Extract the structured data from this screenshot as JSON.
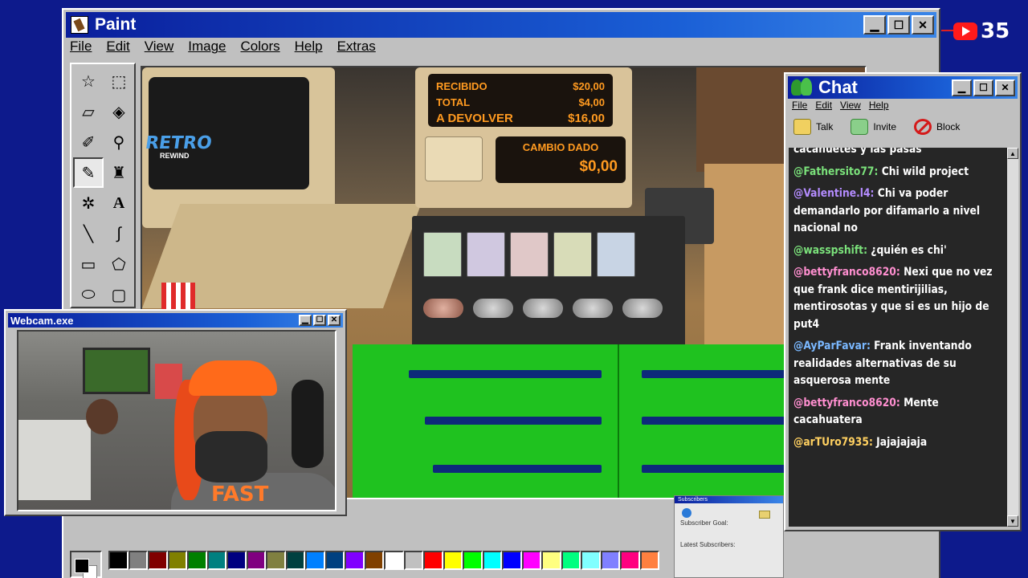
{
  "paint": {
    "title": "Paint",
    "menu": [
      "File",
      "Edit",
      "View",
      "Image",
      "Colors",
      "Help",
      "Extras"
    ],
    "tools": [
      "free-select",
      "rect-select",
      "eraser",
      "fill",
      "color-picker",
      "magnifier",
      "pencil",
      "brush",
      "airbrush",
      "text",
      "line",
      "curve",
      "rectangle",
      "polygon",
      "ellipse",
      "rounded-rectangle"
    ],
    "selected_tool": "pencil",
    "palette": [
      "#000000",
      "#808080",
      "#800000",
      "#808000",
      "#008000",
      "#008080",
      "#000080",
      "#800080",
      "#808040",
      "#004040",
      "#0080ff",
      "#004080",
      "#8000ff",
      "#804000",
      "#ffffff",
      "#c0c0c0",
      "#ff0000",
      "#ffff00",
      "#00ff00",
      "#00ffff",
      "#0000ff",
      "#ff00ff",
      "#ffff80",
      "#00ff80",
      "#80ffff",
      "#8080ff",
      "#ff0080",
      "#ff8040"
    ]
  },
  "game": {
    "register": {
      "received_label": "RECIBIDO",
      "received_value": "$20,00",
      "total_label": "TOTAL",
      "total_value": "$4,00",
      "return_label": "A DEVOLVER",
      "return_value": "$16,00",
      "change_label": "CAMBIO DADO",
      "change_value": "$0,00"
    },
    "sticker_brand": "RETRO",
    "sticker_sub": "REWIND"
  },
  "webcam": {
    "title": "Webcam.exe",
    "shirt_text": "FAST"
  },
  "chat": {
    "title": "Chat",
    "menu": [
      "File",
      "Edit",
      "View",
      "Help"
    ],
    "toolbar": {
      "talk": "Talk",
      "invite": "Invite",
      "block": "Block"
    },
    "messages": [
      {
        "user": "",
        "text": "cacahuetes y las pasas",
        "color": "#ffffff"
      },
      {
        "user": "@Fathersito77:",
        "text": "Chi wild project",
        "color": "#7be27b"
      },
      {
        "user": "@Valentine.l4:",
        "text": "Chi va poder demandarlo por difamarlo a nivel nacional no",
        "color": "#b48cff"
      },
      {
        "user": "@wasspshift:",
        "text": "¿quién es chi'",
        "color": "#7be27b"
      },
      {
        "user": "@bettyfranco8620:",
        "text": "Nexi que no vez que frank dice mentirijilias, mentirosotas y que si es un hijo de put4",
        "color": "#ff8fd0"
      },
      {
        "user": "@AyParFavar:",
        "text": "Frank inventando realidades alternativas de su asquerosa mente",
        "color": "#7ab8ff"
      },
      {
        "user": "@bettyfranco8620:",
        "text": "Mente cacahuatera",
        "color": "#ff8fd0"
      },
      {
        "user": "@arTUro7935:",
        "text": "Jajajajaja",
        "color": "#ffd060"
      }
    ]
  },
  "subscribers": {
    "title": "Subscribers",
    "goal_label": "Subscriber Goal:",
    "latest_label": "Latest Subscribers:"
  },
  "youtube": {
    "count": "35"
  }
}
